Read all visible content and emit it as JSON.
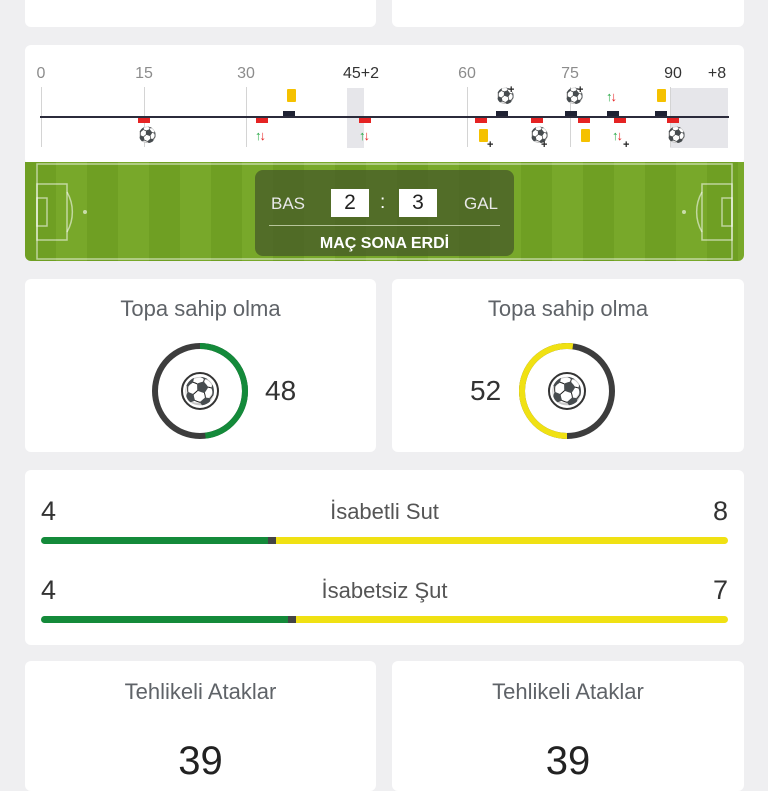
{
  "timeline": {
    "ticks": [
      "0",
      "15",
      "30",
      "45+2",
      "60",
      "75",
      "90",
      "+8"
    ]
  },
  "match": {
    "home_team": "BAS",
    "away_team": "GAL",
    "home_score": "2",
    "away_score": "3",
    "separator": ":",
    "status": "MAÇ SONA ERDİ"
  },
  "possession": {
    "title": "Topa sahip olma",
    "home_value": "48",
    "away_value": "52",
    "home_fraction": 0.48,
    "away_fraction": 0.52,
    "home_color": "#148a3a",
    "away_color": "#f0e113",
    "rest_color": "#3d3d3d",
    "icon": "soccer-ball-icon"
  },
  "shots": [
    {
      "label": "İsabetli Sut",
      "home": "4",
      "away": "8",
      "home_fraction": 0.33
    },
    {
      "label": "İsabetsiz Şut",
      "home": "4",
      "away": "7",
      "home_fraction": 0.36
    }
  ],
  "dangerous_attacks": {
    "title": "Tehlikeli Ataklar",
    "home_value": "39",
    "away_value": "39"
  },
  "colors": {
    "green": "#148a3a",
    "yellow": "#f0e113",
    "red": "#e52323",
    "pitch": "#6f9f23"
  }
}
